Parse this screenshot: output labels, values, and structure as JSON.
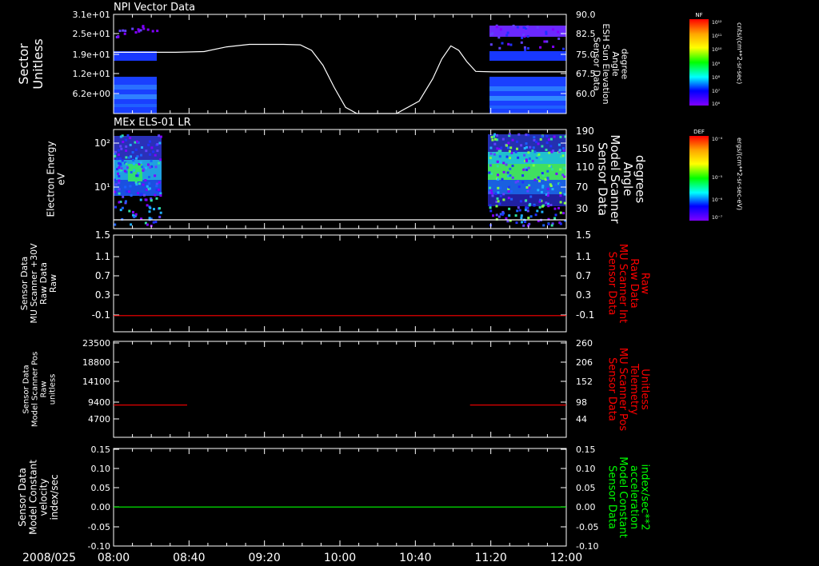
{
  "time_axis": {
    "date_label": "2008/025",
    "ticks": [
      "08:00",
      "08:40",
      "09:20",
      "10:00",
      "10:40",
      "11:20",
      "12:00"
    ],
    "range_hours": [
      8,
      12
    ]
  },
  "chart_data": [
    {
      "type": "heatmap",
      "panel_title": "NPI Vector Data",
      "ylabel": [
        "Sector",
        "Unitless"
      ],
      "yticks": [
        "3.1e+01",
        "2.5e+01",
        "1.9e+01",
        "1.2e+01",
        "6.2e+00"
      ],
      "data_gaps": [
        [
          8.0,
          8.55
        ],
        [
          11.2,
          12.0
        ]
      ],
      "colorbar": {
        "title": "NF",
        "unit_label": "cnts/(cm**2-sr-sec)",
        "ticks": [
          "10¹²",
          "10¹¹",
          "10¹⁰",
          "10⁹",
          "10⁸",
          "10⁷",
          "10⁶"
        ],
        "colors": [
          "#ff0000",
          "#ffa500",
          "#ffff00",
          "#00ff00",
          "#00ffff",
          "#0000ff",
          "#8000ff"
        ]
      },
      "overlay": {
        "type": "line",
        "name": "Sensor Data ESH Sun Elevation Angle",
        "ylabel_right": [
          "Sensor Data",
          "ESH Sun Elevation",
          "Angle",
          "degree"
        ],
        "yticks_right": [
          "90.0",
          "82.5",
          "75.0",
          "67.5",
          "60.0"
        ],
        "ylim": [
          52.5,
          92.5
        ],
        "color": "#ffffff",
        "x": [
          8.0,
          8.55,
          8.8,
          9.0,
          9.2,
          9.5,
          9.65,
          9.75,
          9.85,
          9.95,
          10.05,
          10.15,
          10.5,
          10.7,
          10.82,
          10.9,
          10.98,
          11.05,
          11.12,
          11.2,
          11.35,
          12.0
        ],
        "y": [
          77.2,
          77.2,
          77.5,
          79.4,
          80.4,
          80.4,
          80.2,
          78.0,
          72.0,
          63.0,
          55.0,
          52.5,
          52.5,
          57.5,
          66.5,
          74.5,
          79.8,
          78.0,
          73.5,
          69.5,
          69.3,
          69.3
        ]
      }
    },
    {
      "type": "heatmap",
      "panel_title": "MEx ELS-01 LR",
      "ylabel": [
        "Electron Energy",
        "eV"
      ],
      "yticks": [
        "10²",
        "10¹"
      ],
      "data_gaps": [
        [
          8.0,
          8.6
        ],
        [
          11.2,
          12.0
        ]
      ],
      "colorbar": {
        "title": "DEF",
        "unit_label": "ergs/(cm**2-sr-sec-eV)",
        "ticks": [
          "10⁻⁴",
          "10⁻⁵",
          "10⁻⁶",
          "10⁻⁷"
        ],
        "colors": [
          "#ff0000",
          "#ffa500",
          "#ffff00",
          "#00ff00",
          "#00ffff",
          "#0000ff",
          "#8000ff"
        ]
      },
      "overlay": {
        "type": "line",
        "name": "Sensor Data Model Scanner Angle",
        "ylabel_right": [
          "Sensor Data",
          "Model Scanner",
          "Angle",
          "degrees"
        ],
        "yticks_right": [
          "190",
          "150",
          "110",
          "70",
          "30"
        ],
        "ylim": [
          10,
          190
        ],
        "color": "#ffffff",
        "x": [
          8.0,
          12.0
        ],
        "y": [
          10,
          10
        ]
      }
    },
    {
      "type": "line",
      "ylabel": [
        "Sensor Data",
        "MU Scanner +30V",
        "Raw Data",
        "Raw"
      ],
      "yticks": [
        "1.5",
        "1.1",
        "0.7",
        "0.3",
        "-0.1"
      ],
      "ylim": [
        -0.3,
        1.5
      ],
      "right_axis": {
        "ylabel": [
          "Sensor Data",
          "MU Scanner Int",
          "Raw Data",
          "Raw"
        ],
        "yticks": [
          "1.5",
          "1.1",
          "0.7",
          "0.3",
          "-0.1"
        ],
        "label_color": "#ff0000"
      },
      "series": [
        {
          "color": "#ff0000",
          "x": [
            8.0,
            12.0
          ],
          "y": [
            0.0,
            0.0
          ]
        }
      ]
    },
    {
      "type": "line",
      "ylabel": [
        "Sensor Data",
        "Model Scanner Pos",
        "Raw",
        "unitless"
      ],
      "yticks": [
        "23500",
        "18800",
        "14100",
        "9400",
        "4700"
      ],
      "ylim": [
        0,
        23500
      ],
      "right_axis": {
        "ylabel": [
          "Sensor Data",
          "MU Scanner Pos",
          "Telemetry",
          "Unitless"
        ],
        "yticks": [
          "260",
          "206",
          "152",
          "98",
          "44"
        ],
        "label_color": "#ff0000"
      },
      "series": [
        {
          "color": "#ff0000",
          "x": [
            8.0,
            8.65
          ],
          "y": [
            7900,
            7900
          ]
        },
        {
          "color": "#ff0000",
          "x": [
            11.15,
            12.0
          ],
          "y": [
            7900,
            7900
          ]
        }
      ]
    },
    {
      "type": "line",
      "ylabel": [
        "Sensor Data",
        "Model Constant",
        "velocity",
        "index/sec"
      ],
      "yticks": [
        "0.15",
        "0.10",
        "0.05",
        "0.00",
        "-0.05",
        "-0.10"
      ],
      "ylim": [
        -0.1,
        0.15
      ],
      "right_axis": {
        "ylabel": [
          "Sensor Data",
          "Model Constant",
          "acceleration",
          "index/sec**2"
        ],
        "yticks": [
          "0.15",
          "0.10",
          "0.05",
          "0.00",
          "-0.05",
          "-0.10"
        ],
        "label_color": "#00ff00"
      },
      "series": [
        {
          "color": "#00ff00",
          "x": [
            8.0,
            12.0
          ],
          "y": [
            0.0,
            0.0
          ]
        }
      ]
    }
  ]
}
